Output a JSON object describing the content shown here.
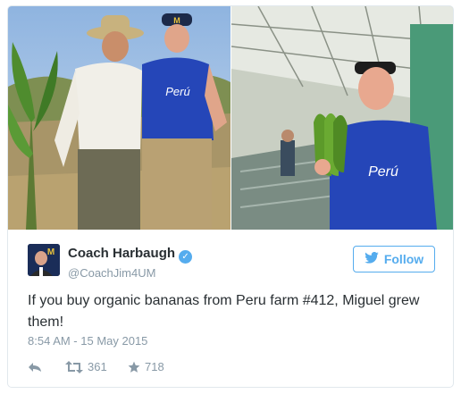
{
  "tweet": {
    "author": {
      "display_name": "Coach Harbaugh",
      "handle": "@CoachJim4UM",
      "verified": true
    },
    "follow_label": "Follow",
    "text": "If you buy organic bananas from Peru farm #412, Miguel grew them!",
    "timestamp": "8:54 AM - 15 May 2015",
    "retweets": "361",
    "likes": "718"
  },
  "media": {
    "shirt_logo_text": "Perú",
    "cap_letter": "M"
  },
  "colors": {
    "twitter_blue": "#55acee",
    "shirt_blue": "#2546b8",
    "meta_gray": "#8899a6"
  },
  "icons": [
    "twitter-bird-icon",
    "verified-badge-icon",
    "reply-icon",
    "retweet-icon",
    "like-star-icon"
  ]
}
